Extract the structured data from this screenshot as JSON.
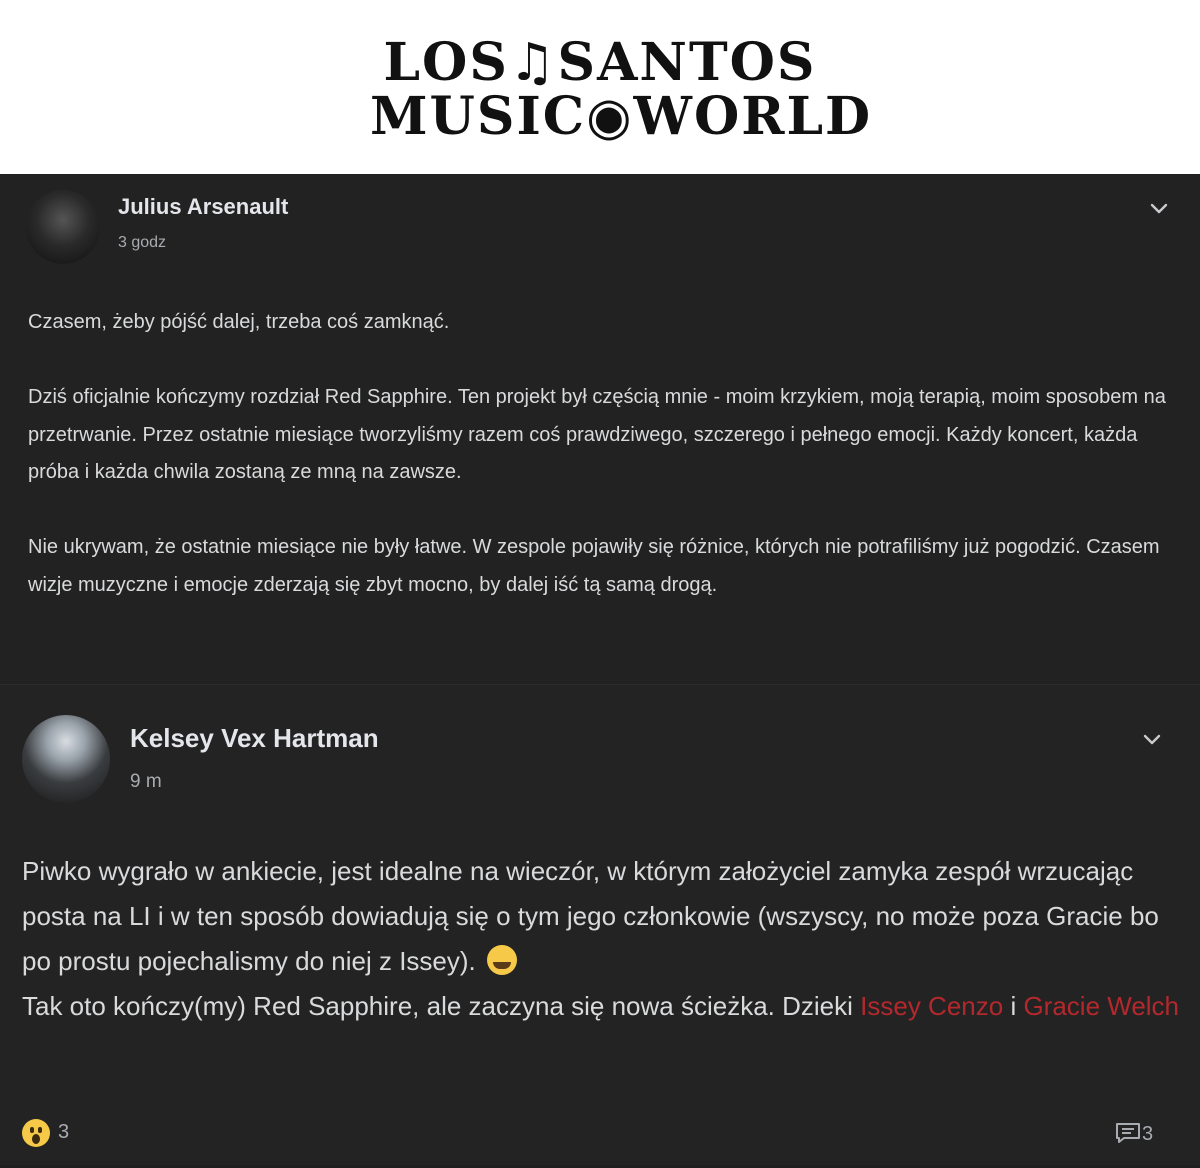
{
  "header": {
    "logo_line1": "LOS♫SANTOS",
    "logo_line2": "MUSIC◉WORLD",
    "logo_accent": "#6a2c8f"
  },
  "post1": {
    "author": "Julius Arsenault",
    "time": "3 godz",
    "paragraphs": [
      "Czasem, żeby pójść dalej, trzeba coś zamknąć.",
      "Dziś oficjalnie kończymy rozdział Red Sapphire. Ten projekt był częścią mnie - moim krzykiem, moją terapią, moim sposobem na przetrwanie. Przez ostatnie miesiące tworzyliśmy razem coś prawdziwego, szczerego i pełnego emocji. Każdy koncert, każda próba i każda chwila zostaną ze mną na zawsze.",
      "Nie ukrywam, że ostatnie miesiące nie były łatwe. W zespole pojawiły się różnice, których nie potrafiliśmy już pogodzić. Czasem wizje muzyczne i emocje zderzają się zbyt mocno, by dalej iść tą samą drogą."
    ]
  },
  "post2": {
    "author": "Kelsey Vex Hartman",
    "time": "9 m",
    "line1": "Piwko wygrało w ankiecie, jest idealne na wieczór, w którym założyciel zamyka zespół wrzucając posta na LI i w ten sposób dowiadują się o tym jego członkowie (wszyscy, no może poza Gracie bo po prostu pojechalismy do niej z Issey).",
    "line2_prefix": "Tak oto kończy(my) Red Sapphire, ale zaczyna się nowa ścieżka. Dzieki ",
    "mention1": "Issey Cenzo",
    "between": " i ",
    "mention2": "Gracie Welch",
    "reaction_count": "3",
    "comment_count": "3",
    "mention_color": "#b3282d"
  }
}
